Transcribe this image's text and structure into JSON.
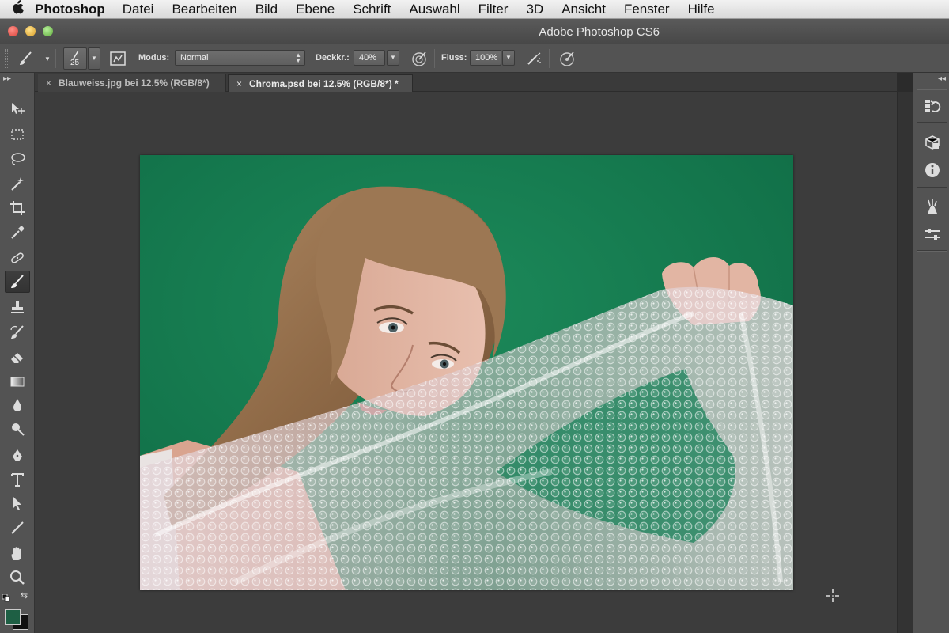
{
  "menubar": {
    "apple_icon": "apple-icon",
    "app_name": "Photoshop",
    "items": [
      "Datei",
      "Bearbeiten",
      "Bild",
      "Ebene",
      "Schrift",
      "Auswahl",
      "Filter",
      "3D",
      "Ansicht",
      "Fenster",
      "Hilfe"
    ]
  },
  "window": {
    "title": "Adobe Photoshop CS6"
  },
  "options": {
    "brush_size": "25",
    "modus_label": "Modus:",
    "modus_value": "Normal",
    "deckkraft_label": "Deckkr.:",
    "deckkraft_value": "40%",
    "fluss_label": "Fluss:",
    "fluss_value": "100%"
  },
  "tabs": [
    {
      "label": "Blauweiss.jpg bei 12.5% (RGB/8*)",
      "active": false
    },
    {
      "label": "Chroma.psd bei 12.5% (RGB/8*) *",
      "active": true
    }
  ],
  "tab_close_glyph": "×",
  "collapse_left_glyph": "▸▸",
  "collapse_right_glyph": "◂◂",
  "colors": {
    "foreground": "#1e5f44",
    "background": "#111111",
    "green_screen": "#1c8a5a"
  },
  "tools": [
    "move-tool",
    "marquee-tool",
    "lasso-tool",
    "magic-wand-tool",
    "crop-tool",
    "eyedropper-tool",
    "healing-brush-tool",
    "brush-tool",
    "clone-stamp-tool",
    "history-brush-tool",
    "eraser-tool",
    "gradient-tool",
    "blur-tool",
    "dodge-tool",
    "pen-tool",
    "type-tool",
    "path-selection-tool",
    "line-tool",
    "hand-tool",
    "zoom-tool"
  ],
  "dock_icons": [
    "history-panel-icon",
    "3d-panel-icon",
    "info-panel-icon",
    "tool-presets-icon",
    "properties-panel-icon"
  ]
}
